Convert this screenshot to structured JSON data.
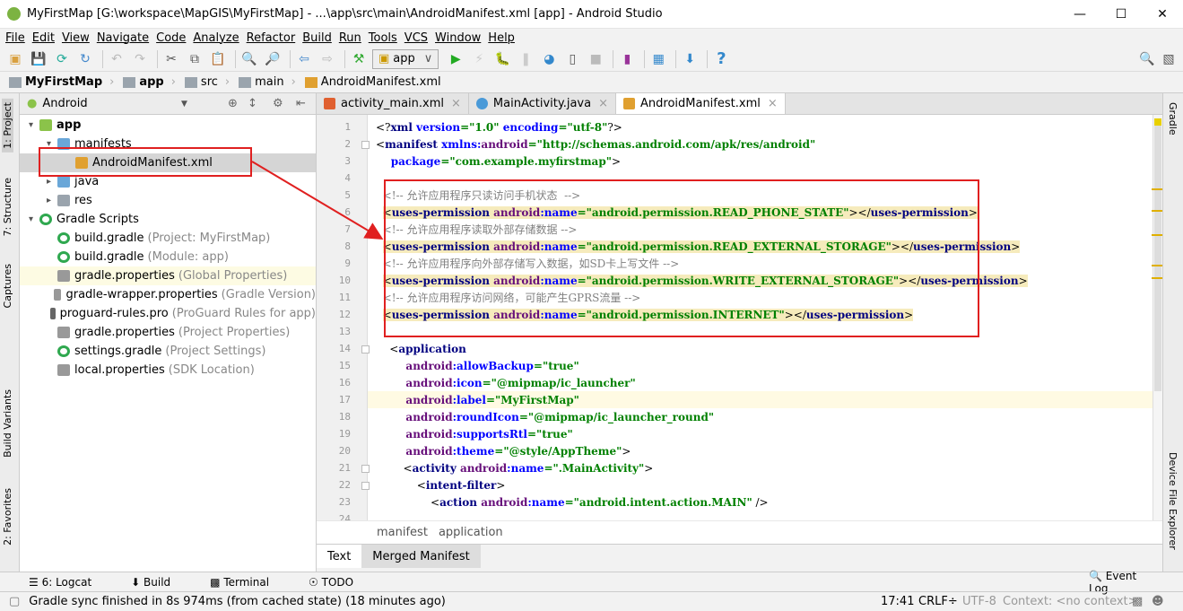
{
  "window": {
    "title": "MyFirstMap [G:\\workspace\\MapGIS\\MyFirstMap] - ...\\app\\src\\main\\AndroidManifest.xml [app] - Android Studio"
  },
  "menu": [
    "File",
    "Edit",
    "View",
    "Navigate",
    "Code",
    "Analyze",
    "Refactor",
    "Build",
    "Run",
    "Tools",
    "VCS",
    "Window",
    "Help"
  ],
  "toolbar": {
    "run_config": "app"
  },
  "breadcrumb": [
    "MyFirstMap",
    "app",
    "src",
    "main",
    "AndroidManifest.xml"
  ],
  "left_strip": [
    "1: Project",
    "7: Structure",
    "Captures",
    "Build Variants",
    "2: Favorites"
  ],
  "right_strip": [
    "Gradle",
    "Device File Explorer"
  ],
  "project": {
    "view_mode": "Android",
    "items": [
      {
        "label": "app",
        "hint": "",
        "bold": true
      },
      {
        "label": "manifests",
        "hint": ""
      },
      {
        "label": "AndroidManifest.xml",
        "hint": ""
      },
      {
        "label": "java",
        "hint": ""
      },
      {
        "label": "res",
        "hint": ""
      },
      {
        "label": "Gradle Scripts",
        "hint": ""
      },
      {
        "label": "build.gradle",
        "hint": "(Project: MyFirstMap)"
      },
      {
        "label": "build.gradle",
        "hint": "(Module: app)"
      },
      {
        "label": "gradle.properties",
        "hint": "(Global Properties)"
      },
      {
        "label": "gradle-wrapper.properties",
        "hint": "(Gradle Version)"
      },
      {
        "label": "proguard-rules.pro",
        "hint": "(ProGuard Rules for app)"
      },
      {
        "label": "gradle.properties",
        "hint": "(Project Properties)"
      },
      {
        "label": "settings.gradle",
        "hint": "(Project Settings)"
      },
      {
        "label": "local.properties",
        "hint": "(SDK Location)"
      }
    ]
  },
  "tabs": [
    {
      "label": "activity_main.xml"
    },
    {
      "label": "MainActivity.java"
    },
    {
      "label": "AndroidManifest.xml",
      "active": true
    }
  ],
  "code": [
    [
      [
        "pu",
        "<?"
      ],
      [
        "tg",
        "xml "
      ],
      [
        "at",
        "version"
      ],
      [
        "vl",
        "=\"1.0\" "
      ],
      [
        "at",
        "encoding"
      ],
      [
        "vl",
        "=\"utf-8\""
      ],
      [
        "pu",
        "?>"
      ]
    ],
    [
      [
        "pu",
        "<"
      ],
      [
        "tg",
        "manifest "
      ],
      [
        "at",
        "xmlns:"
      ],
      [
        "an",
        "android"
      ],
      [
        "vl",
        "=\"http://schemas.android.com/apk/res/android\""
      ]
    ],
    [
      [
        "at",
        "    package"
      ],
      [
        "vl",
        "=\"com.example.myfirstmap\""
      ],
      [
        "pu",
        ">"
      ]
    ],
    [],
    [
      [
        "cm",
        "<!-- 允许应用程序只读访问手机状态  -->"
      ]
    ],
    [
      [
        "pu",
        "<"
      ],
      [
        "tg",
        "uses-permission "
      ],
      [
        "an",
        "android"
      ],
      [
        "at",
        ":name"
      ],
      [
        "vl",
        "=\"android.permission.READ_PHONE_STATE\""
      ],
      [
        "pu",
        "></"
      ],
      [
        "tg",
        "uses-permission"
      ],
      [
        "pu",
        ">"
      ]
    ],
    [
      [
        "cm",
        "<!-- 允许应用程序读取外部存储数据 -->"
      ]
    ],
    [
      [
        "pu",
        "<"
      ],
      [
        "tg",
        "uses-permission "
      ],
      [
        "an",
        "android"
      ],
      [
        "at",
        ":name"
      ],
      [
        "vl",
        "=\"android.permission.READ_EXTERNAL_STORAGE\""
      ],
      [
        "pu",
        "></"
      ],
      [
        "tg",
        "uses-permission"
      ],
      [
        "pu",
        ">"
      ]
    ],
    [
      [
        "cm",
        "<!-- 允许应用程序向外部存储写入数据，如SD卡上写文件 -->"
      ]
    ],
    [
      [
        "pu",
        "<"
      ],
      [
        "tg",
        "uses-permission "
      ],
      [
        "an",
        "android"
      ],
      [
        "at",
        ":name"
      ],
      [
        "vl",
        "=\"android.permission.WRITE_EXTERNAL_STORAGE\""
      ],
      [
        "pu",
        "></"
      ],
      [
        "tg",
        "uses-permission"
      ],
      [
        "pu",
        ">"
      ]
    ],
    [
      [
        "cm",
        "<!-- 允许应用程序访问网络，可能产生GPRS流量 -->"
      ]
    ],
    [
      [
        "pu",
        "<"
      ],
      [
        "tg",
        "uses-permission "
      ],
      [
        "an",
        "android"
      ],
      [
        "at",
        ":name"
      ],
      [
        "vl",
        "=\"android.permission.INTERNET\""
      ],
      [
        "pu",
        "></"
      ],
      [
        "tg",
        "uses-permission"
      ],
      [
        "pu",
        ">"
      ]
    ],
    [],
    [
      [
        "pu",
        "    <"
      ],
      [
        "tg",
        "application"
      ]
    ],
    [
      [
        "an",
        "        android"
      ],
      [
        "at",
        ":allowBackup"
      ],
      [
        "vl",
        "=\"true\""
      ]
    ],
    [
      [
        "an",
        "        android"
      ],
      [
        "at",
        ":icon"
      ],
      [
        "vl",
        "=\"@mipmap/ic_launcher\""
      ]
    ],
    [
      [
        "an",
        "        android"
      ],
      [
        "at",
        ":label"
      ],
      [
        "vl",
        "=\"MyFirstMap\""
      ]
    ],
    [
      [
        "an",
        "        android"
      ],
      [
        "at",
        ":roundIcon"
      ],
      [
        "vl",
        "=\"@mipmap/ic_launcher_round\""
      ]
    ],
    [
      [
        "an",
        "        android"
      ],
      [
        "at",
        ":supportsRtl"
      ],
      [
        "vl",
        "=\"true\""
      ]
    ],
    [
      [
        "an",
        "        android"
      ],
      [
        "at",
        ":theme"
      ],
      [
        "vl",
        "=\"@style/AppTheme\""
      ],
      [
        "pu",
        ">"
      ]
    ],
    [
      [
        "pu",
        "        <"
      ],
      [
        "tg",
        "activity "
      ],
      [
        "an",
        "android"
      ],
      [
        "at",
        ":name"
      ],
      [
        "vl",
        "=\".MainActivity\""
      ],
      [
        "pu",
        ">"
      ]
    ],
    [
      [
        "pu",
        "            <"
      ],
      [
        "tg",
        "intent-filter"
      ],
      [
        "pu",
        ">"
      ]
    ],
    [
      [
        "pu",
        "                <"
      ],
      [
        "tg",
        "action "
      ],
      [
        "an",
        "android"
      ],
      [
        "at",
        ":name"
      ],
      [
        "vl",
        "=\"android.intent.action.MAIN\""
      ],
      [
        "pu",
        " />"
      ]
    ]
  ],
  "editor_breadcrumb": [
    "manifest",
    "application"
  ],
  "bottom_tabs": [
    "Text",
    "Merged Manifest"
  ],
  "tool_windows": [
    "6: Logcat",
    "Build",
    "Terminal",
    "TODO"
  ],
  "event_log": "Event Log",
  "status": {
    "message": "Gradle sync finished in 8s 974ms (from cached state) (18 minutes ago)",
    "position": "17:41",
    "line_sep": "CRLF÷",
    "encoding": "UTF-8",
    "context": "Context: <no context>"
  },
  "colors": {
    "annotation": "#e02020",
    "highlight": "#f6ebbc"
  }
}
